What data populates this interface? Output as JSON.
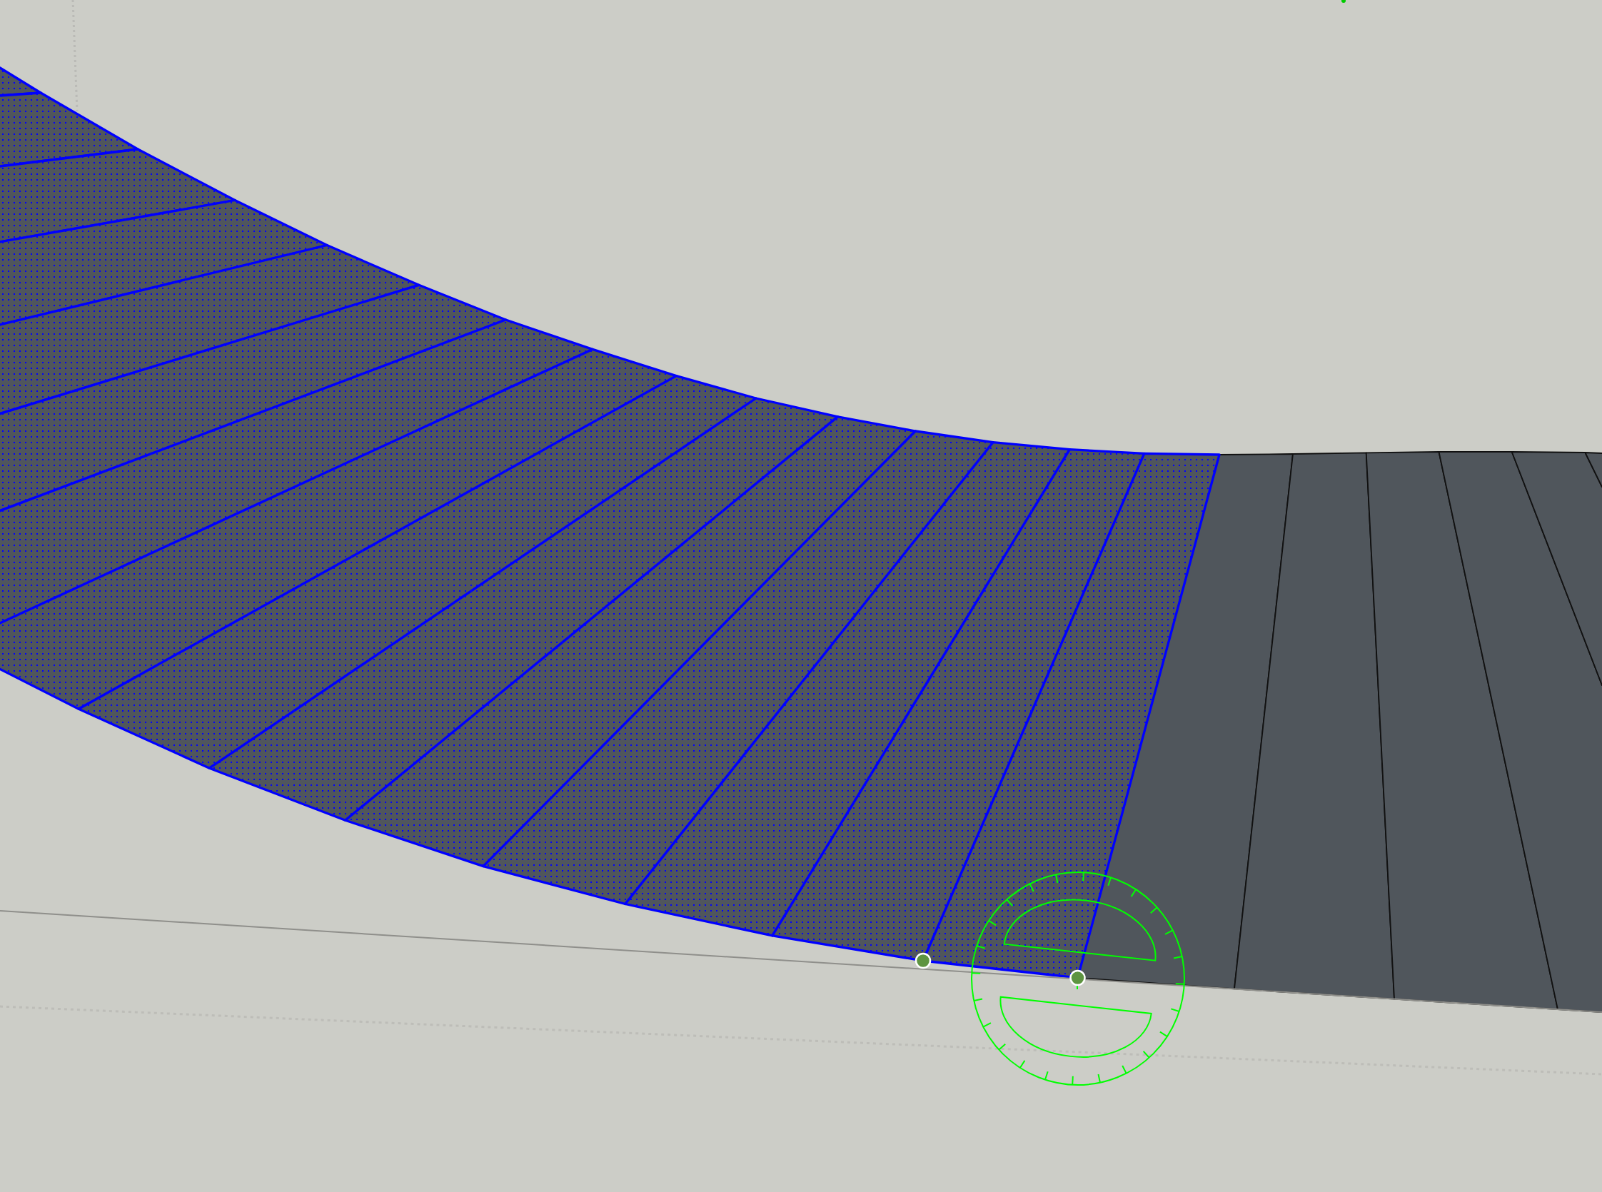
{
  "viewport": {
    "faces": [
      {
        "selected": true
      },
      {
        "selected": true
      },
      {
        "selected": true
      },
      {
        "selected": true
      },
      {
        "selected": true
      },
      {
        "selected": true
      },
      {
        "selected": true
      },
      {
        "selected": true
      },
      {
        "selected": true
      },
      {
        "selected": true
      },
      {
        "selected": true
      },
      {
        "selected": true
      },
      {
        "selected": true
      },
      {
        "selected": true
      },
      {
        "selected": true
      },
      {
        "selected": false
      },
      {
        "selected": false
      },
      {
        "selected": false
      },
      {
        "selected": false
      },
      {
        "selected": false
      },
      {
        "selected": false
      }
    ]
  }
}
